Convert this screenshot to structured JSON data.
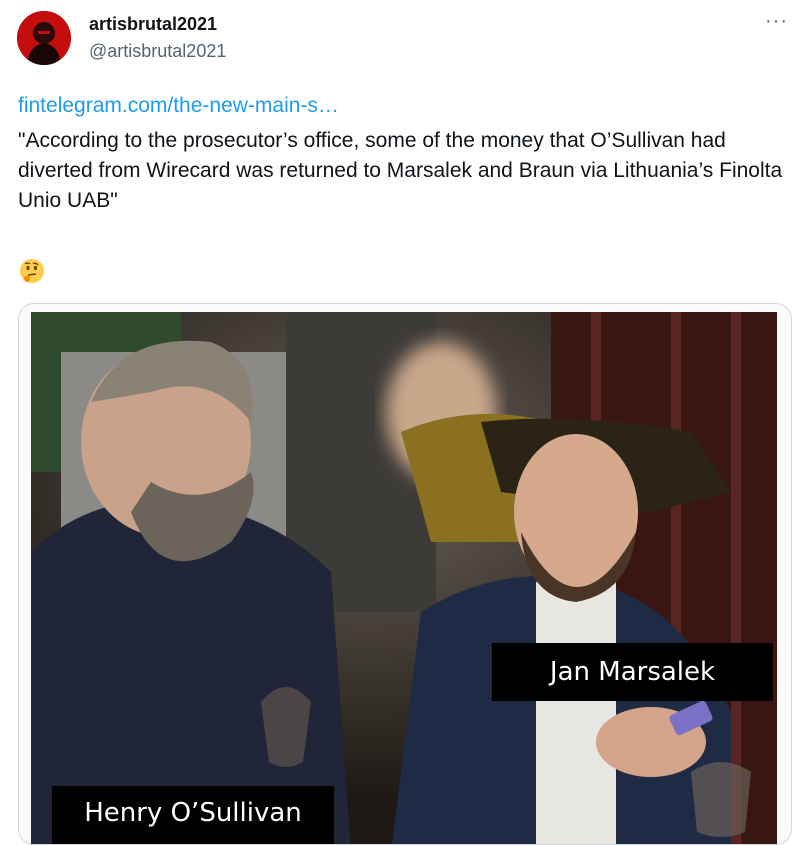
{
  "tweet": {
    "author_name": "artisbrutal2021",
    "author_handle": "@artisbrutal2021",
    "link_text": "fintelegram.com/the-new-main-s…",
    "text": "\"According to the prosecutor’s office, some of the money that O’Sullivan had diverted from Wirecard was returned to Marsalek and Braun via Lithuania’s Finolta Unio UAB\"",
    "emoji": "thinking-face-emoji"
  },
  "menu": {
    "icon": "more-options-icon",
    "label": "···"
  },
  "media": {
    "caption_1": "Jan Marsalek",
    "caption_2": "Henry O’Sullivan"
  },
  "colors": {
    "link": "#1d9bf0",
    "secondary_text": "#536471",
    "border": "#cfd9de"
  }
}
